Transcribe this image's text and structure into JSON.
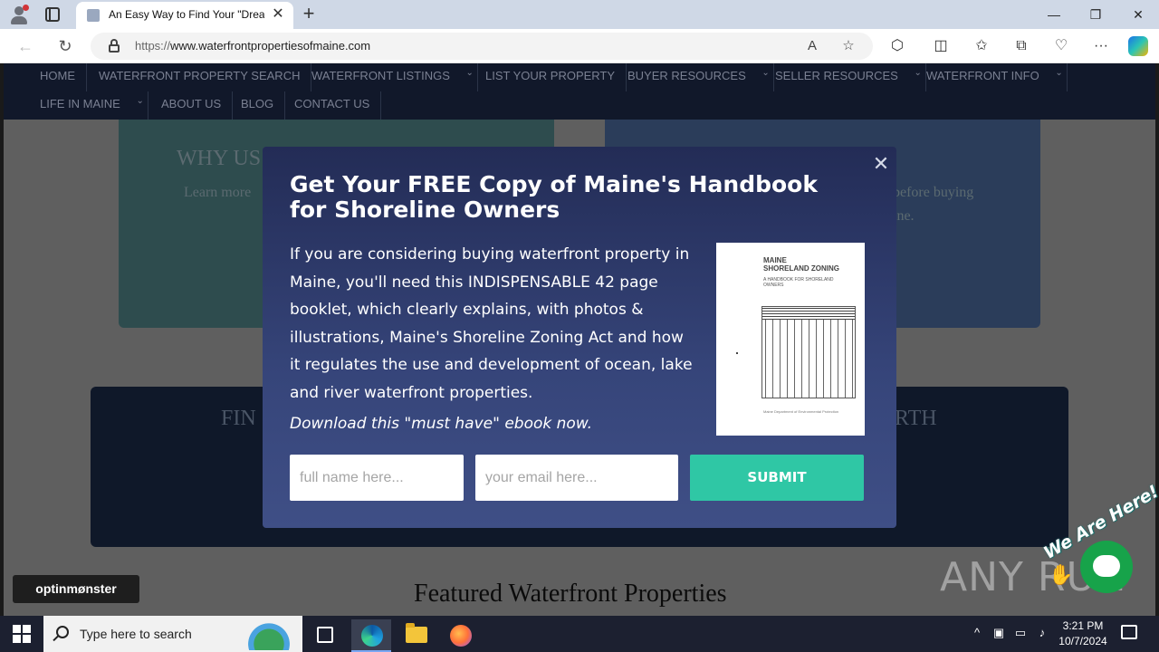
{
  "browser": {
    "tab_title": "An Easy Way to Find Your \"Dream",
    "tab_close_glyph": "✕",
    "new_tab_glyph": "+",
    "url_scheme": "https://",
    "url_host": "www.waterfrontpropertiesofmaine.com",
    "window_controls": {
      "minimize": "—",
      "maximize": "❐",
      "close": "✕"
    },
    "icons": [
      "back-icon",
      "refresh-icon",
      "lock-icon",
      "read-aloud-icon",
      "favorite-icon",
      "extensions-icon",
      "split-screen-icon",
      "favorites-icon",
      "collections-icon",
      "browser-essentials-icon",
      "more-icon",
      "copilot-icon"
    ]
  },
  "site_nav": {
    "row1": [
      {
        "label": "HOME",
        "dropdown": false
      },
      {
        "label": "WATERFRONT PROPERTY SEARCH",
        "dropdown": false
      },
      {
        "label": "WATERFRONT LISTINGS",
        "dropdown": true
      },
      {
        "label": "LIST YOUR PROPERTY",
        "dropdown": false
      },
      {
        "label": "BUYER RESOURCES",
        "dropdown": true
      },
      {
        "label": "SELLER RESOURCES",
        "dropdown": true
      },
      {
        "label": "WATERFRONT INFO",
        "dropdown": true
      }
    ],
    "row2": [
      {
        "label": "LIFE IN MAINE",
        "dropdown": true
      },
      {
        "label": "ABOUT US",
        "dropdown": false
      },
      {
        "label": "BLOG",
        "dropdown": false
      },
      {
        "label": "CONTACT US",
        "dropdown": false
      }
    ]
  },
  "background": {
    "panel1_heading": "WHY US",
    "panel1_text": "Learn more",
    "panel2_text_line1": "before buying",
    "panel2_text_line2": "ine.",
    "panel3_left": "FIN",
    "panel3_right": "RTH",
    "featured_heading": "Featured Waterfront Properties"
  },
  "optinmonster_badge": "optinmønster",
  "modal": {
    "close_glyph": "✕",
    "title": "Get Your FREE Copy of Maine's Handbook for Shoreline Owners",
    "body": "If you are considering buying waterfront property in Maine, you'll need this INDISPENSABLE 42 page booklet, which clearly explains, with photos & illustrations, Maine's Shoreline Zoning Act and how it regulates the use and development of ocean, lake and river waterfront properties.",
    "cta": "Download this \"must have\" ebook now.",
    "book": {
      "title_line1": "MAINE",
      "title_line2": "SHORELAND ZONING",
      "subtitle": "A HANDBOOK FOR SHORELAND OWNERS",
      "footer": "Maine Department of Environmental Protection"
    },
    "name_placeholder": "full name here...",
    "email_placeholder": "your email here...",
    "submit_label": "SUBMIT"
  },
  "chat_widget": {
    "banner": "We Are Here!"
  },
  "watermark": "ANY RUN",
  "taskbar": {
    "search_placeholder": "Type here to search",
    "time": "3:21 PM",
    "date": "10/7/2024"
  }
}
